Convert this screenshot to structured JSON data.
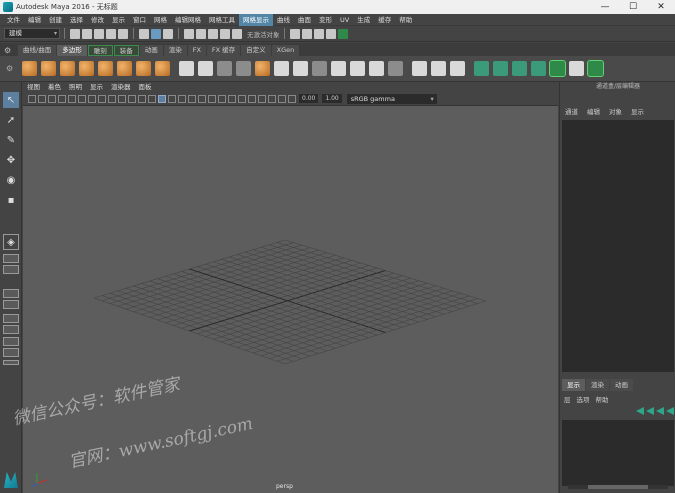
{
  "window": {
    "title": "Autodesk Maya 2016 - 无标题",
    "minimize": "—",
    "maximize": "☐",
    "close": "✕"
  },
  "menubar": {
    "items": [
      "文件",
      "编辑",
      "创建",
      "选择",
      "修改",
      "显示",
      "窗口",
      "网格",
      "编辑网格",
      "网格工具",
      "网格显示",
      "曲线",
      "曲面",
      "变形",
      "UV",
      "生成",
      "缓存",
      "帮助"
    ],
    "active_index": 10
  },
  "statusline": {
    "mode_dropdown": "建模",
    "live_surface": "无激活对象"
  },
  "shelf": {
    "tabs": [
      "曲线/曲面",
      "多边形",
      "雕刻",
      "装备",
      "动画",
      "渲染",
      "FX",
      "FX 缓存",
      "自定义",
      "XGen"
    ],
    "active_index": 1,
    "green_indices": [
      2,
      3
    ],
    "icons": [
      {
        "name": "sphere",
        "style": "orange"
      },
      {
        "name": "cube",
        "style": "orange"
      },
      {
        "name": "cylinder",
        "style": "orange"
      },
      {
        "name": "cone",
        "style": "orange"
      },
      {
        "name": "torus",
        "style": "orange"
      },
      {
        "name": "plane",
        "style": "orange"
      },
      {
        "name": "disc",
        "style": "orange"
      },
      {
        "name": "platonic",
        "style": "orange"
      },
      {
        "name": "combine",
        "style": "white"
      },
      {
        "name": "separate",
        "style": "white"
      },
      {
        "name": "extract",
        "style": "gray"
      },
      {
        "name": "smooth",
        "style": "gray"
      },
      {
        "name": "boolean",
        "style": "orange"
      },
      {
        "name": "average",
        "style": "white"
      },
      {
        "name": "bridge",
        "style": "white"
      },
      {
        "name": "fill-hole",
        "style": "gray"
      },
      {
        "name": "append",
        "style": "white"
      },
      {
        "name": "cut",
        "style": "white"
      },
      {
        "name": "multi-cut",
        "style": "white"
      },
      {
        "name": "target-weld",
        "style": "gray"
      },
      {
        "name": "bevel",
        "style": "white"
      },
      {
        "name": "extrude",
        "style": "white"
      },
      {
        "name": "merge",
        "style": "white"
      },
      {
        "name": "uv-planar",
        "style": "teal"
      },
      {
        "name": "uv-cylindrical",
        "style": "teal"
      },
      {
        "name": "uv-spherical",
        "style": "teal"
      },
      {
        "name": "uv-auto",
        "style": "teal"
      },
      {
        "name": "uv-editor",
        "style": "green-sel"
      },
      {
        "name": "uv-checker",
        "style": "white"
      },
      {
        "name": "uv-layout",
        "style": "green-sel"
      }
    ]
  },
  "viewport": {
    "menu": [
      "视图",
      "着色",
      "照明",
      "显示",
      "渲染器",
      "面板"
    ],
    "exposure": "0.00",
    "gamma": "1.00",
    "color_space": "sRGB gamma",
    "camera_label": "persp"
  },
  "right_panel": {
    "title": "通道盒/层编辑器",
    "menu": [
      "通道",
      "编辑",
      "对象",
      "显示"
    ],
    "layer_tabs": [
      "显示",
      "渲染",
      "动画"
    ],
    "layer_tabs_active": 0,
    "layer_menu": [
      "层",
      "选项",
      "帮助"
    ]
  },
  "watermark": {
    "line1": "微信公众号：软件管家",
    "line2": "官网：www.softgj.com"
  }
}
